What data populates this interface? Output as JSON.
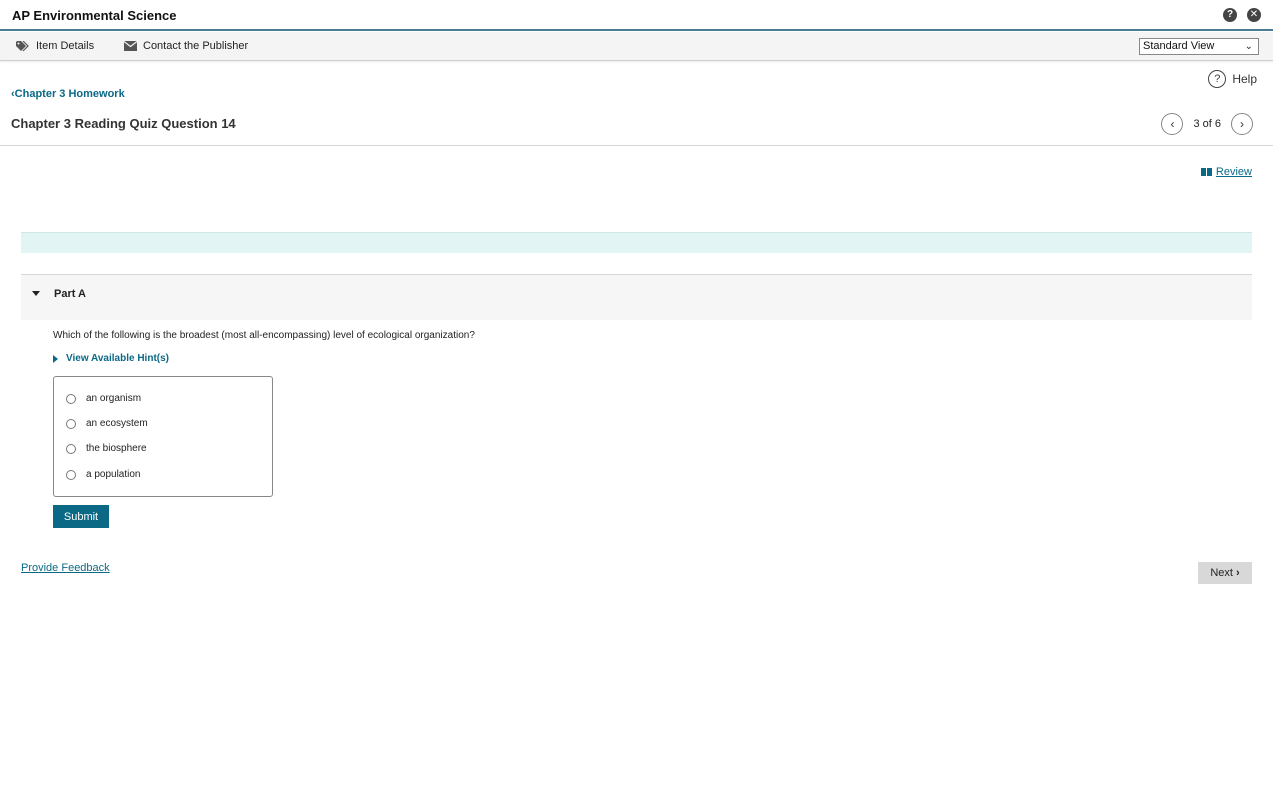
{
  "app": {
    "title": "AP Environmental Science"
  },
  "toolbar": {
    "item_details": "Item Details",
    "contact_publisher": "Contact the Publisher",
    "view_select": "Standard View"
  },
  "help": {
    "label": "Help"
  },
  "nav": {
    "back_link": "Chapter 3 Homework",
    "question_title": "Chapter 3 Reading Quiz Question 14",
    "position": "3 of 6"
  },
  "review": {
    "label": "Review"
  },
  "part": {
    "label": "Part A",
    "question": "Which of the following is the broadest (most all-encompassing) level of ecological organization?",
    "hint_link": "View Available Hint(s)",
    "choices": [
      "an organism",
      "an ecosystem",
      "the biosphere",
      "a population"
    ],
    "submit_label": "Submit"
  },
  "footer": {
    "feedback": "Provide Feedback",
    "next": "Next"
  },
  "colors": {
    "accent": "#0b6986",
    "banner": "#e3f4f4",
    "title_border": "#4a7d93"
  },
  "icons": {
    "help_window": "question-circle-icon",
    "close_window": "close-circle-icon",
    "item_details": "tag-icon",
    "contact": "envelope-icon",
    "review": "book-icon"
  }
}
